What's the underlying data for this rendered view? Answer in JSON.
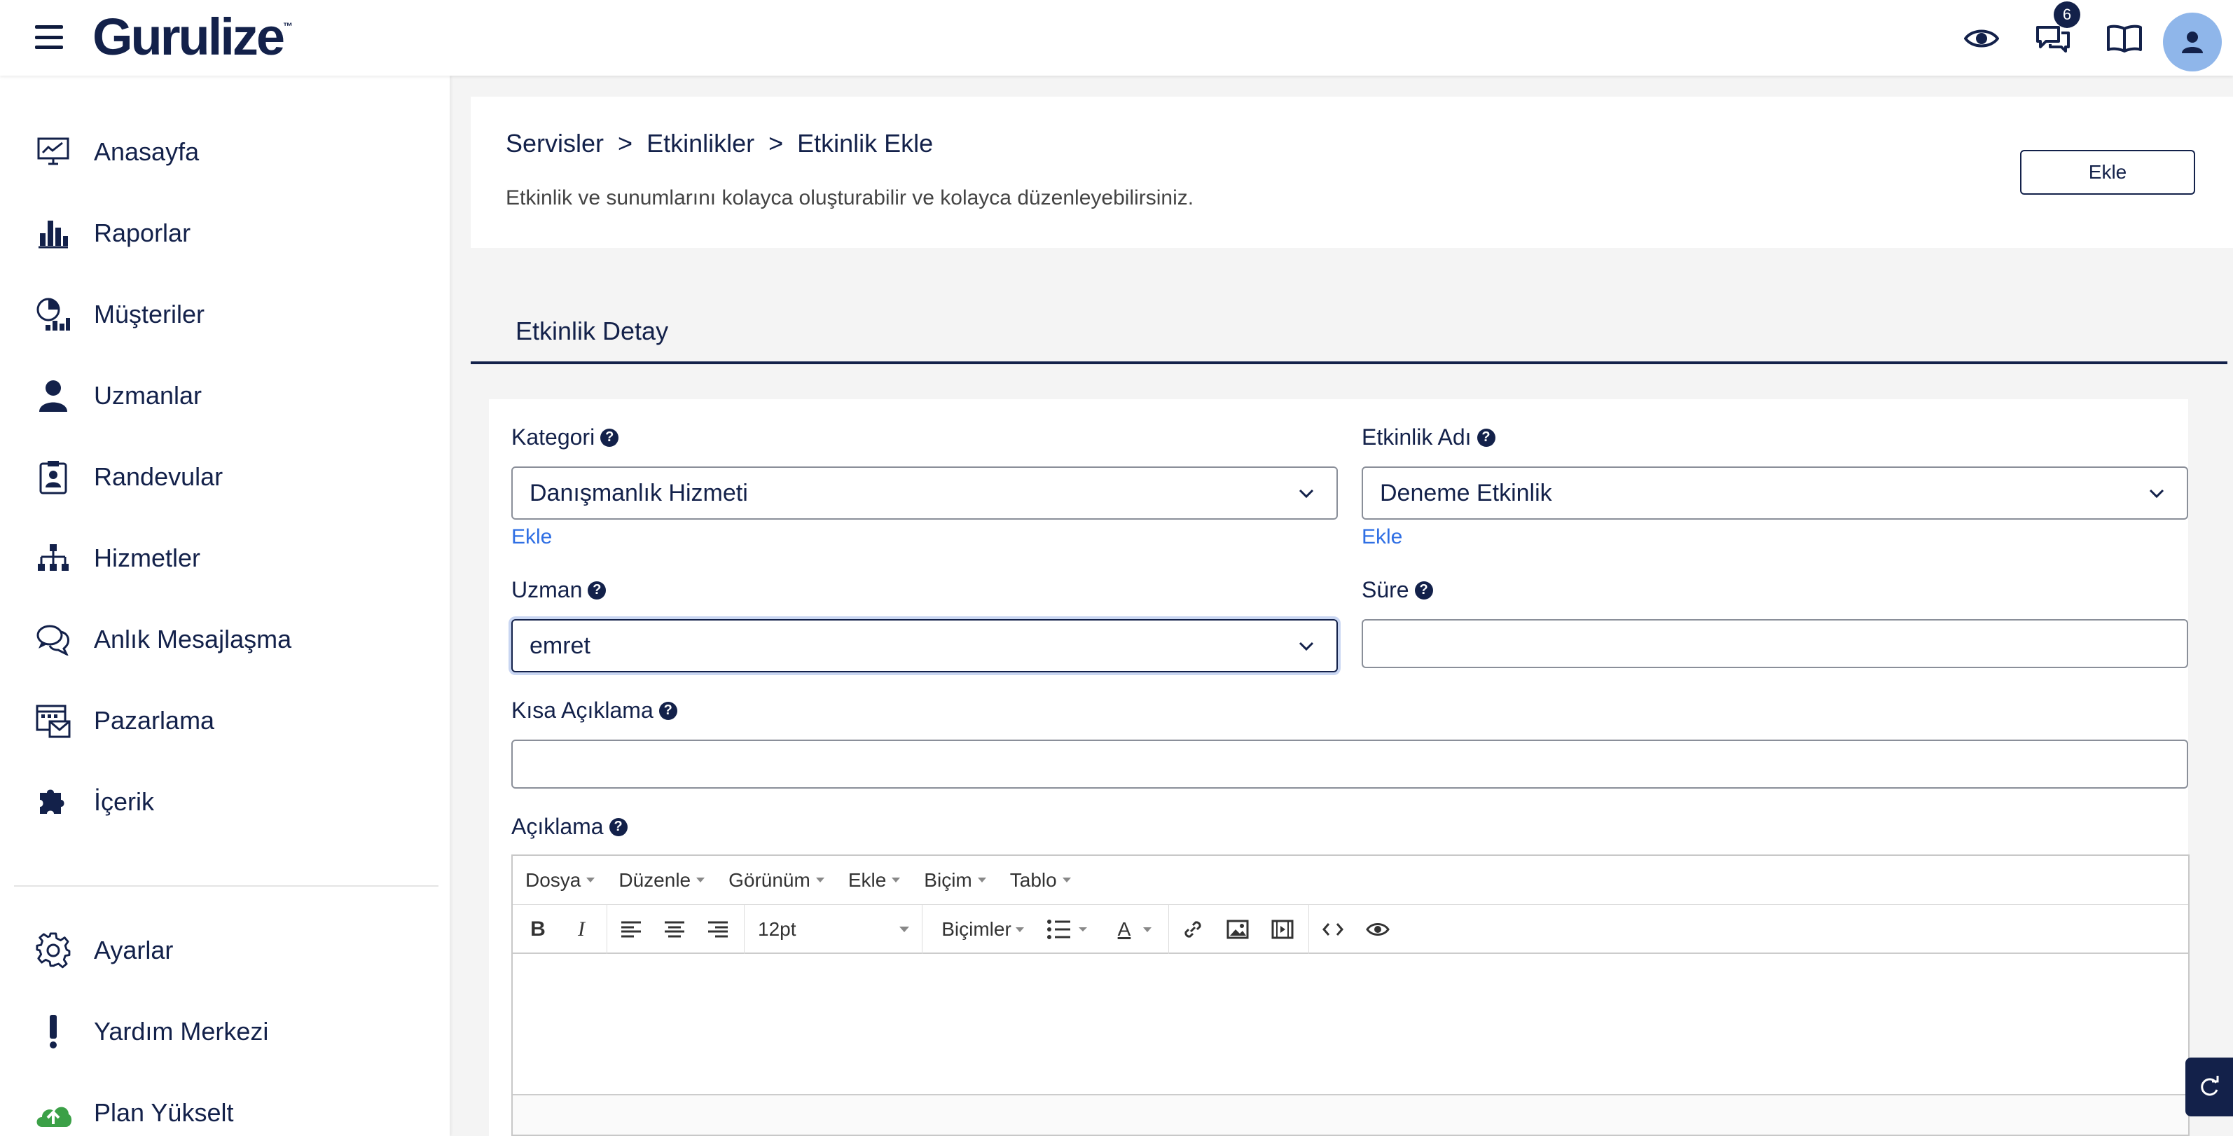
{
  "app": {
    "logo": "Gurulize",
    "logo_mark": "™"
  },
  "topbar": {
    "messages_badge": "6"
  },
  "sidebar": {
    "items": [
      {
        "label": "Anasayfa",
        "icon": "chart-monitor-icon"
      },
      {
        "label": "Raporlar",
        "icon": "bar-chart-icon"
      },
      {
        "label": "Müşteriler",
        "icon": "pie-chart-icon"
      },
      {
        "label": "Uzmanlar",
        "icon": "user-icon"
      },
      {
        "label": "Randevular",
        "icon": "clipboard-user-icon"
      },
      {
        "label": "Hizmetler",
        "icon": "sitemap-icon"
      },
      {
        "label": "Anlık Mesajlaşma",
        "icon": "chat-icon"
      },
      {
        "label": "Pazarlama",
        "icon": "mail-calendar-icon"
      },
      {
        "label": "İçerik",
        "icon": "puzzle-icon"
      },
      {
        "label": "Ayarlar",
        "icon": "gear-icon"
      },
      {
        "label": "Yardım Merkezi",
        "icon": "exclamation-icon"
      },
      {
        "label": "Plan Yükselt",
        "icon": "cloud-upload-icon"
      }
    ]
  },
  "header": {
    "breadcrumb": [
      "Servisler",
      "Etkinlikler",
      "Etkinlik Ekle"
    ],
    "breadcrumb_sep": ">",
    "subtitle": "Etkinlik ve sunumlarını kolayca oluşturabilir ve kolayca düzenleyebilirsiniz.",
    "add_button": "Ekle"
  },
  "tab": {
    "label": "Etkinlik Detay"
  },
  "form": {
    "kategori": {
      "label": "Kategori",
      "value": "Danışmanlık Hizmeti",
      "add_link": "Ekle"
    },
    "etkinlik_adi": {
      "label": "Etkinlik Adı",
      "value": "Deneme Etkinlik",
      "add_link": "Ekle"
    },
    "uzman": {
      "label": "Uzman",
      "value": "emret"
    },
    "sure": {
      "label": "Süre",
      "value": ""
    },
    "kisa_aciklama": {
      "label": "Kısa Açıklama",
      "value": ""
    },
    "aciklama": {
      "label": "Açıklama"
    },
    "help_glyph": "?"
  },
  "editor": {
    "menus": [
      "Dosya",
      "Düzenle",
      "Görünüm",
      "Ekle",
      "Biçim",
      "Tablo"
    ],
    "font_size": "12pt",
    "formats_label": "Biçimler",
    "bold": "B",
    "italic": "I",
    "text_color": "A"
  }
}
